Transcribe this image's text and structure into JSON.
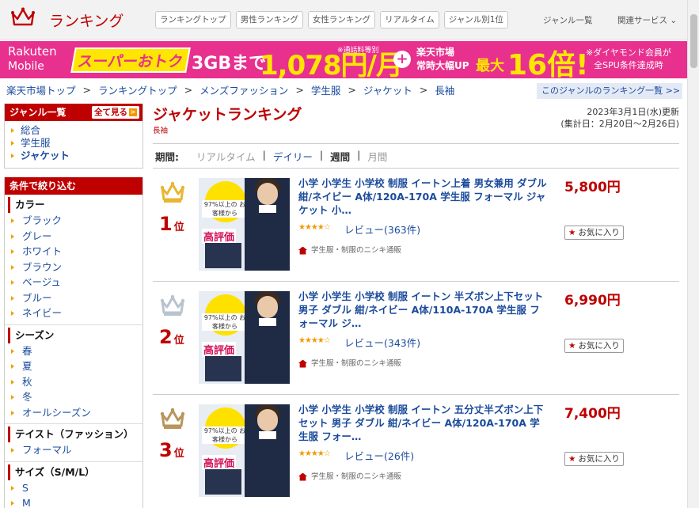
{
  "header": {
    "title": "ランキング",
    "tabs": [
      "ランキングトップ",
      "男性ランキング",
      "女性ランキング",
      "リアルタイム",
      "ジャンル別1位"
    ],
    "genre_list": "ジャンル一覧",
    "related": "関連サービス ⌄"
  },
  "banner": {
    "brand1": "Rakuten",
    "brand2": "Mobile",
    "super": "スーパーおトク",
    "gb": "3GBまで",
    "price": "1,078円/月",
    "note": "※通話料等別",
    "plus": "+",
    "market1": "楽天市場",
    "market2": "常時大幅UP",
    "max": "最大",
    "max_value": "16倍!",
    "spu1": "※ダイヤモンド会員が",
    "spu2": "全SPU条件達成時"
  },
  "breadcrumb": [
    "楽天市場トップ",
    "ランキングトップ",
    "メンズファッション",
    "学生服",
    "ジャケット",
    "長袖"
  ],
  "genre_ranking_link": "このジャンルのランキング一覧 >>",
  "sidebar": {
    "genre_header": "ジャンル一覧",
    "see_all": "全て見る",
    "genres": [
      "総合",
      "学生服",
      "ジャケット"
    ],
    "filter_header": "条件で絞り込む",
    "filters": [
      {
        "category": "カラー",
        "items": [
          "ブラック",
          "グレー",
          "ホワイト",
          "ブラウン",
          "ベージュ",
          "ブルー",
          "ネイビー"
        ]
      },
      {
        "category": "シーズン",
        "items": [
          "春",
          "夏",
          "秋",
          "冬",
          "オールシーズン"
        ]
      },
      {
        "category": "テイスト（ファッション）",
        "items": [
          "フォーマル"
        ]
      },
      {
        "category": "サイズ（S/M/L）",
        "items": [
          "S",
          "M"
        ]
      }
    ]
  },
  "main": {
    "title": "ジャケットランキング",
    "subtitle": "長袖",
    "updated": "2023年3月1日(水)更新",
    "period_range": "(集計日：2月20日～2月26日)",
    "period_label": "期間:",
    "period_options": [
      "リアルタイム",
      "デイリー",
      "週間",
      "月間"
    ]
  },
  "rankings": [
    {
      "rank": "1",
      "rank_suffix": "位",
      "title": "小学 小学生 小学校 制服 イートン上着 男女兼用 ダブル 紺/ネイビー A体/120A-170A 学生服 フォーマル ジャケット 小…",
      "price": "5,800円",
      "review": "レビュー(363件)",
      "shop": "学生服・制服のニシキ通販",
      "fav": "お気に入り",
      "crown_color": "#e8b632",
      "badge": "97%以上の お客様から",
      "hyoka": "高評価"
    },
    {
      "rank": "2",
      "rank_suffix": "位",
      "title": "小学 小学生 小学校 制服 イートン 半ズボン上下セット 男子 ダブル 紺/ネイビー A体/110A-170A 学生服 フォーマル ジ…",
      "price": "6,990円",
      "review": "レビュー(343件)",
      "shop": "学生服・制服のニシキ通販",
      "fav": "お気に入り",
      "crown_color": "#b9c3cf",
      "badge": "97%以上の お客様から",
      "hyoka": "高評価"
    },
    {
      "rank": "3",
      "rank_suffix": "位",
      "title": "小学 小学生 小学校 制服 イートン 五分丈半ズボン上下セット 男子 ダブル 紺/ネイビー A体/120A-170A 学生服 フォー…",
      "price": "7,400円",
      "review": "レビュー(26件)",
      "shop": "学生服・制服のニシキ通販",
      "fav": "お気に入り",
      "crown_color": "#b8955a",
      "badge": "97%以上の お客様から",
      "hyoka": "高評価"
    }
  ],
  "rating_stars": "★★★★☆",
  "icons": [
    "crown-logo-icon",
    "chevron-down-icon",
    "star-icon",
    "home-icon",
    "arrow-right-icon"
  ]
}
